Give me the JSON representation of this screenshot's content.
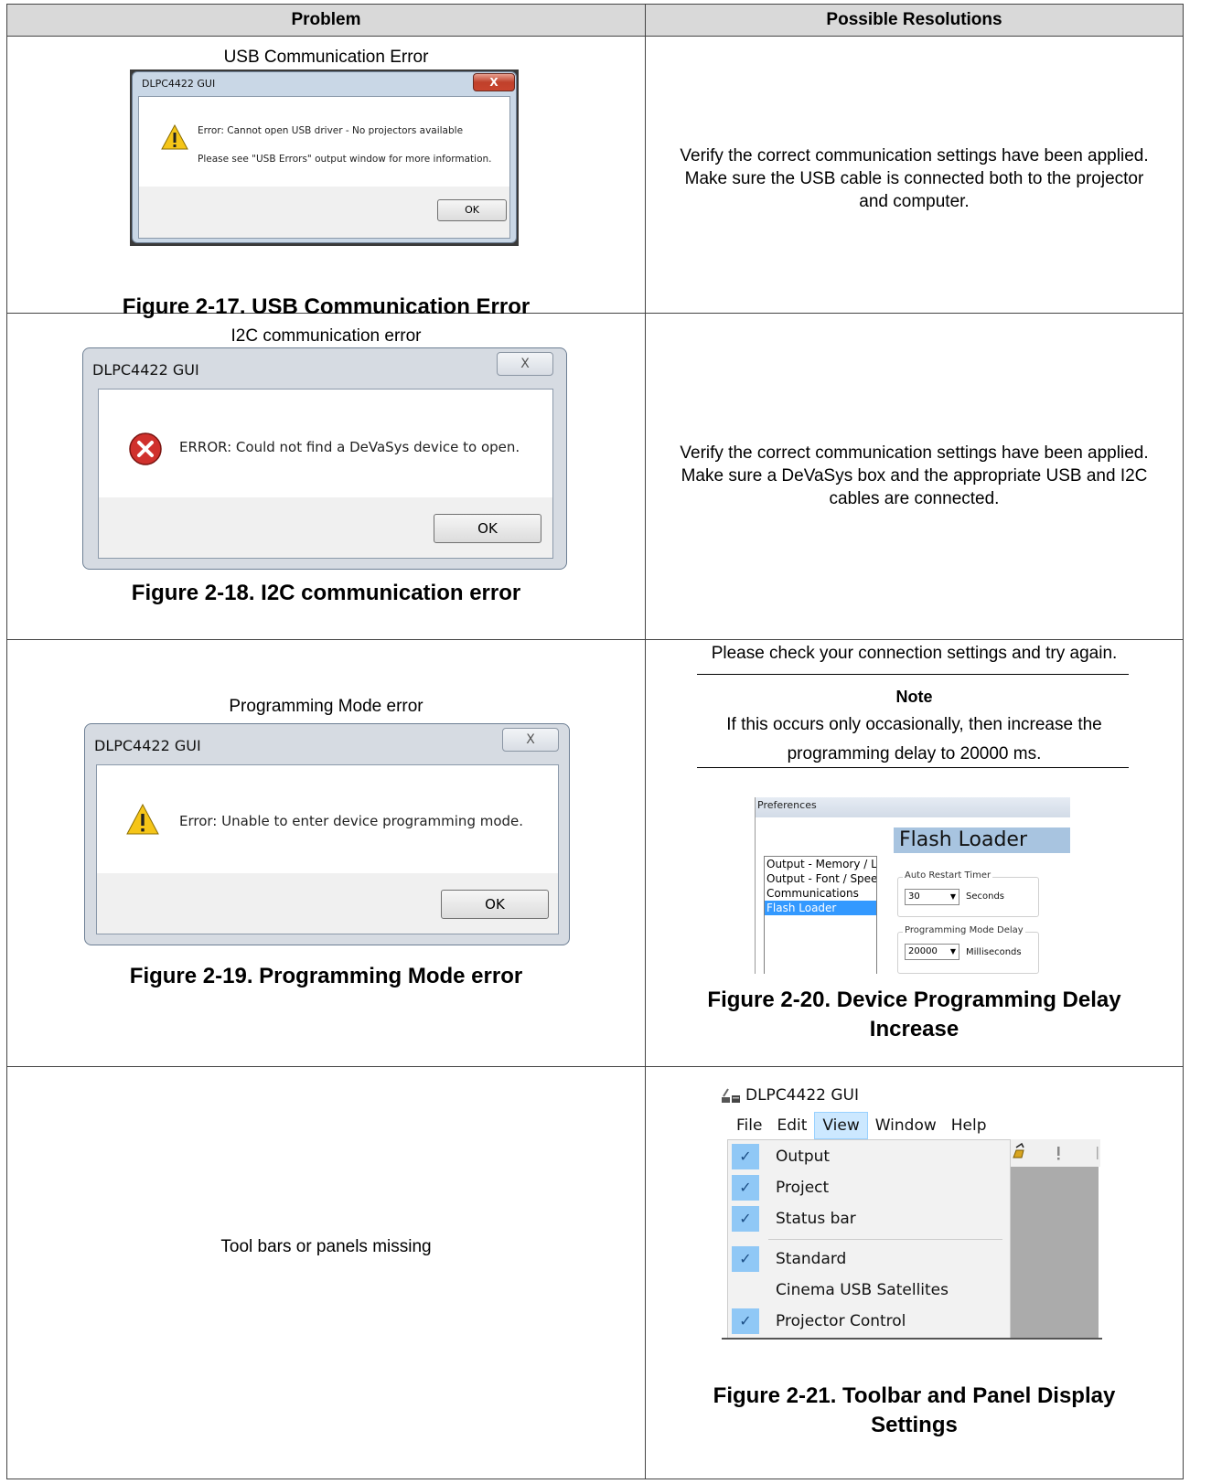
{
  "table": {
    "headers": [
      "Problem",
      "Possible Resolutions"
    ],
    "rows": [
      {
        "problem_title": "USB Communication Error",
        "dialog": {
          "title": "DLPC4422 GUI",
          "line1": "Error: Cannot open USB driver - No projectors available",
          "line2": "Please see \"USB Errors\" output window for more information.",
          "button": "OK",
          "close": "X"
        },
        "caption": "Figure 2-17. USB Communication Error",
        "resolution": [
          "Verify the correct communication settings have been applied.",
          "Make sure the USB cable is connected both to the projector",
          "and computer."
        ]
      },
      {
        "problem_title": "I2C communication error",
        "dialog": {
          "title": "DLPC4422 GUI",
          "message": "ERROR: Could not find a DeVaSys device to open.",
          "button": "OK",
          "close": "X"
        },
        "caption": "Figure 2-18. I2C communication error",
        "resolution": [
          "Verify the correct communication settings have been applied.",
          "Make sure a DeVaSys box and the appropriate USB and I2C",
          "cables are connected."
        ]
      },
      {
        "problem_title": "Programming Mode error",
        "dialog": {
          "title": "DLPC4422 GUI",
          "message": "Error: Unable to enter device programming mode.",
          "button": "OK",
          "close": "X"
        },
        "caption": "Figure 2-19. Programming Mode error",
        "resolution_text": "Please check your connection settings and try again.",
        "note": {
          "heading": "Note",
          "line1": "If this occurs only occasionally, then increase the",
          "line2": "programming delay to 20000 ms."
        },
        "preferences": {
          "window_title": "Preferences",
          "heading": "Flash Loader",
          "list": [
            "Output - Memory / Lo",
            "Output - Font / Spee",
            "Communications",
            "Flash Loader"
          ],
          "selected_index": 3,
          "auto_restart_label": "Auto Restart Timer",
          "auto_restart_value": "30",
          "auto_restart_unit": "Seconds",
          "prog_delay_label": "Programming Mode Delay",
          "prog_delay_value": "20000",
          "prog_delay_unit": "Milliseconds"
        },
        "resolution_caption": [
          "Figure 2-20. Device Programming Delay",
          "Increase"
        ]
      },
      {
        "problem_title": "Tool bars or panels missing",
        "menu": {
          "app_title": "DLPC4422 GUI",
          "menubar": [
            "File",
            "Edit",
            "View",
            "Window",
            "Help"
          ],
          "active_menu": "View",
          "items": [
            {
              "label": "Output",
              "checked": true
            },
            {
              "label": "Project",
              "checked": true
            },
            {
              "label": "Status bar",
              "checked": true
            },
            {
              "label": "Standard",
              "checked": true
            },
            {
              "label": "Cinema USB Satellites",
              "checked": false
            },
            {
              "label": "Projector Control",
              "checked": true
            }
          ],
          "check_glyph": "✓"
        },
        "resolution_caption": [
          "Figure 2-21. Toolbar and Panel Display",
          "Settings"
        ]
      }
    ]
  },
  "colors": {
    "header_bg": "#d9d9d9",
    "menu_check_bg": "#90c8f6",
    "pref_heading_bg": "#a8c4e0",
    "selection": "#3399ff"
  }
}
